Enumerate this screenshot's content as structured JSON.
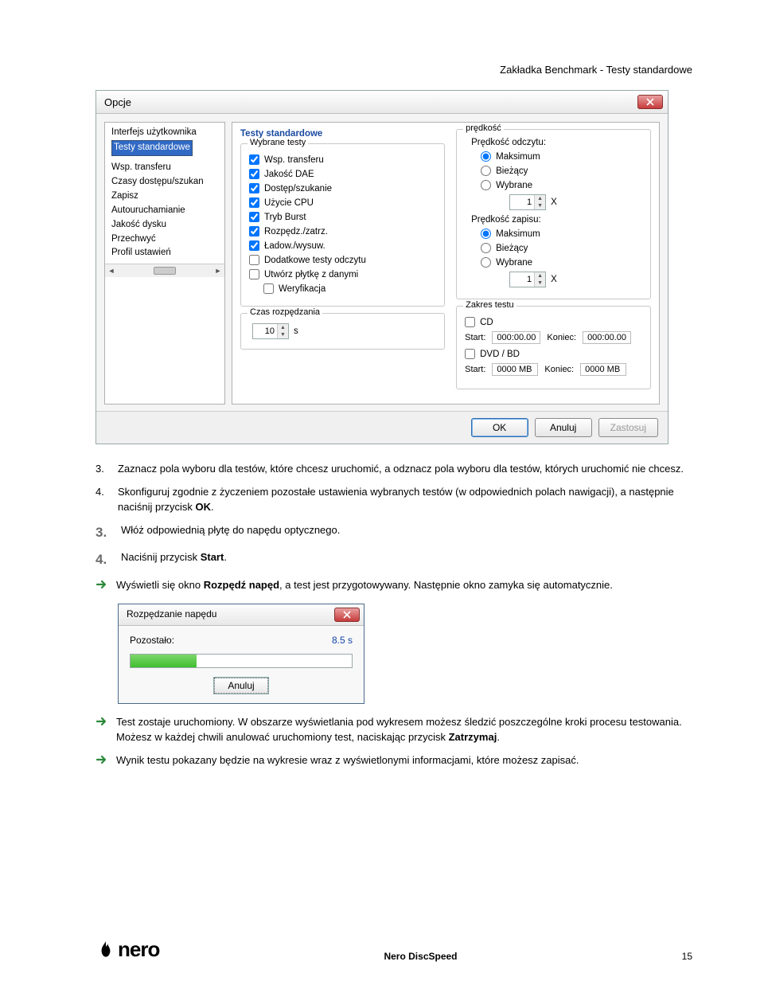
{
  "header": {
    "title": "Zakładka Benchmark - Testy standardowe"
  },
  "dialog": {
    "title": "Opcje",
    "tree": {
      "items": [
        "Interfejs użytkownika",
        "Testy standardowe",
        "Wsp. transferu",
        "Czasy dostępu/szukan",
        "Zapisz",
        "Autouruchamianie",
        "Jakość dysku",
        "Przechwyć",
        "Profil ustawień"
      ],
      "selected_index": 1
    },
    "content_title": "Testy standardowe",
    "tests_group": {
      "label": "Wybrane testy",
      "items": [
        {
          "label": "Wsp. transferu",
          "checked": true
        },
        {
          "label": "Jakość DAE",
          "checked": true
        },
        {
          "label": "Dostęp/szukanie",
          "checked": true
        },
        {
          "label": "Użycie CPU",
          "checked": true
        },
        {
          "label": "Tryb Burst",
          "checked": true
        },
        {
          "label": "Rozpędz./zatrz.",
          "checked": true
        },
        {
          "label": "Ładow./wysuw.",
          "checked": true
        },
        {
          "label": "Dodatkowe testy odczytu",
          "checked": false
        },
        {
          "label": "Utwórz płytkę z danymi",
          "checked": false
        },
        {
          "label": "Weryfikacja",
          "checked": false,
          "indent": true
        }
      ]
    },
    "spinup_group": {
      "label": "Czas rozpędzania",
      "value": "10",
      "unit": "s"
    },
    "speed_group": {
      "label": "prędkość",
      "read_label": "Prędkość odczytu:",
      "write_label": "Prędkość zapisu:",
      "options": [
        "Maksimum",
        "Bieżący",
        "Wybrane"
      ],
      "read_selected": "Maksimum",
      "write_selected": "Maksimum",
      "read_value": "1",
      "write_value": "1",
      "x": "X"
    },
    "range_group": {
      "label": "Zakres testu",
      "cd_label": "CD",
      "cd_start_label": "Start:",
      "cd_start": "000:00.00",
      "cd_end_label": "Koniec:",
      "cd_end": "000:00.00",
      "dvd_label": "DVD / BD",
      "dvd_start_label": "Start:",
      "dvd_start": "0000 MB",
      "dvd_end_label": "Koniec:",
      "dvd_end": "0000 MB"
    },
    "buttons": {
      "ok": "OK",
      "cancel": "Anuluj",
      "apply": "Zastosuj"
    }
  },
  "instructions": {
    "item3_num": "3.",
    "item3": "Zaznacz pola wyboru dla testów, które chcesz uruchomić, a odznacz pola wyboru dla testów, których uruchomić nie chcesz.",
    "item4_num": "4.",
    "item4_pre": "Skonfiguruj zgodnie z życzeniem pozostałe ustawienia wybranych testów (w odpowiednich polach nawigacji), a następnie naciśnij przycisk ",
    "item4_bold": "OK",
    "item4_post": ".",
    "big3_num": "3.",
    "big3": "Włóż odpowiednią płytę do napędu optycznego.",
    "big4_num": "4.",
    "big4_pre": "Naciśnij przycisk ",
    "big4_bold": "Start",
    "big4_post": ".",
    "arrow1_pre": "Wyświetli się okno ",
    "arrow1_bold": "Rozpędź napęd",
    "arrow1_post": ", a test jest przygotowywany. Następnie okno zamyka się automatycznie.",
    "arrow2_a": "Test zostaje uruchomiony. W obszarze wyświetlania pod wykresem możesz śledzić poszczególne kroki procesu testowania.",
    "arrow2_b_pre": "Możesz w każdej chwili anulować uruchomiony test, naciskając przycisk ",
    "arrow2_b_bold": "Zatrzymaj",
    "arrow2_b_post": ".",
    "arrow3": "Wynik testu pokazany będzie na wykresie wraz z wyświetlonymi informacjami, które możesz zapisać."
  },
  "small_dialog": {
    "title": "Rozpędzanie napędu",
    "remaining_label": "Pozostało:",
    "remaining_value": "8.5 s",
    "cancel": "Anuluj"
  },
  "footer": {
    "logo_text": "nero",
    "product": "Nero DiscSpeed",
    "page": "15"
  }
}
